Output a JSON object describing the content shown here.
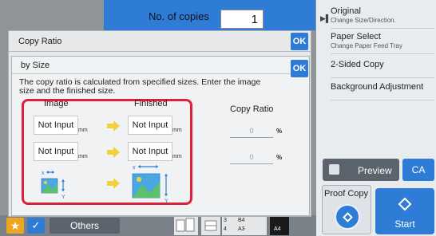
{
  "header": {
    "copies_label": "No. of copies",
    "copies_value": "1"
  },
  "right_panel": {
    "items": [
      {
        "label": "Original",
        "sub": "Change Size/Direction."
      },
      {
        "label": "Paper Select",
        "sub": "Change Paper Feed Tray"
      },
      {
        "label": "2-Sided Copy",
        "sub": ""
      },
      {
        "label": "Background Adjustment",
        "sub": ""
      }
    ],
    "preview_label": "Preview",
    "ca_label": "CA",
    "proof_copy_label": "Proof Copy",
    "start_label": "Start"
  },
  "outer_dialog": {
    "title": "Copy Ratio",
    "ok_label": "OK"
  },
  "inner_dialog": {
    "title": "by Size",
    "ok_label": "OK",
    "description": "The copy ratio is calculated from specified sizes. Enter the image size and the finished size.",
    "image_header": "Image",
    "finished_header": "Finished",
    "copy_ratio_header": "Copy Ratio",
    "rows": [
      {
        "image": "Not Input",
        "image_unit": "mm",
        "finished": "Not Input",
        "finished_unit": "mm",
        "ratio": "0",
        "ratio_unit": "%"
      },
      {
        "image": "Not Input",
        "image_unit": "mm",
        "finished": "Not Input",
        "finished_unit": "mm",
        "ratio": "0",
        "ratio_unit": "%"
      }
    ]
  },
  "bottom_bar": {
    "star": "★",
    "check": "✓",
    "others_label": "Others",
    "tray_lines": [
      "3",
      "4",
      "B4",
      "A3"
    ],
    "tray_size": "A4"
  },
  "colors": {
    "accent": "#2e7cd6",
    "highlight": "#e0203a",
    "arrow": "#f2d23a",
    "favorite": "#f0a51e"
  }
}
